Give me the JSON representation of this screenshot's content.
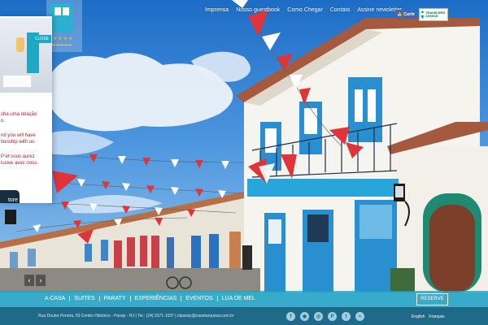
{
  "top_nav": [
    "Imprensa",
    "Nosso guestbook",
    "Como Chegar",
    "Contato",
    "Assine newsletter"
  ],
  "facebook_like": "Curtir",
  "tripadvisor_badge": "TRAVELERS' CHOICE",
  "popup": {
    "close_label": "CLOSE",
    "lines": [
      "sha uma relação",
      "o.",
      "nd you will have",
      "tionship with us.",
      "P et vous aurez",
      "lusive avec nous."
    ],
    "store_button": "tore"
  },
  "slider": {
    "prev_label": "‹",
    "next_label": "›"
  },
  "main_nav": [
    "A CASA",
    "SUITES",
    "PARATY",
    "EXPERIÊNCIAS",
    "EVENTOS",
    "LUA DE MEL"
  ],
  "reserve_button": "RESERVE",
  "footer": {
    "address": "Rua Doutor Pereira, 50 Centro Histórico - Paraty - RJ | Tel.: (24) 3371-1037 | ctparaty@casaturquesa.com.br",
    "social_icons": [
      "facebook-icon",
      "instagram-icon",
      "tripadvisor-icon",
      "pinterest-icon",
      "twitter-icon",
      "rss-icon"
    ],
    "languages": [
      "English",
      "Français"
    ]
  },
  "colors": {
    "turquoise": "#23a5c2",
    "footer_blue": "#1f6a88",
    "popup_red": "#b21b2c",
    "facebook": "#4267b2"
  }
}
